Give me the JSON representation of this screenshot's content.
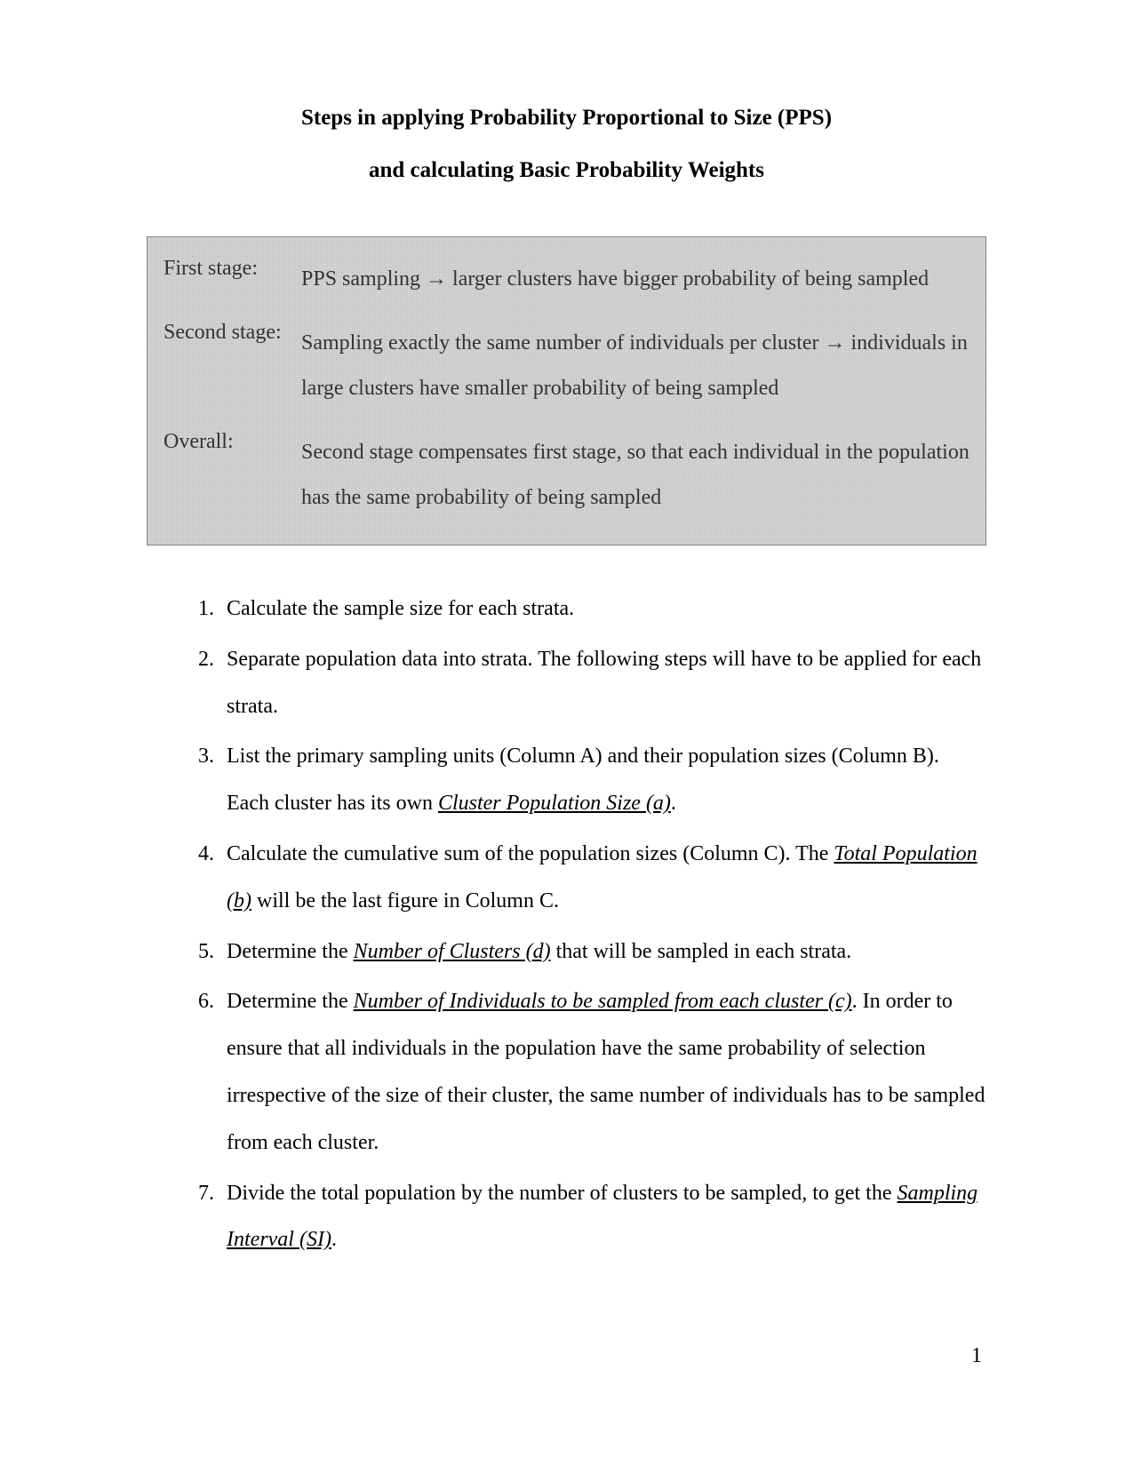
{
  "title": {
    "line1": "Steps in applying Probability Proportional to Size (PPS)",
    "line2": "and calculating Basic Probability Weights"
  },
  "callout": {
    "rows": [
      {
        "label": "First stage:",
        "text": "PPS sampling → larger clusters have bigger probability of being sampled"
      },
      {
        "label": "Second stage:",
        "text": "Sampling exactly the same number of individuals per cluster → individuals in large clusters have smaller probability of being sampled"
      },
      {
        "label": "Overall:",
        "text": "Second stage compensates first stage, so that each individual in the population has the same probability of being sampled"
      }
    ]
  },
  "steps": [
    {
      "num": "1.",
      "parts": [
        {
          "t": "Calculate the sample size for each strata."
        }
      ]
    },
    {
      "num": "2.",
      "parts": [
        {
          "t": "Separate population data into strata. The following steps will have to be applied for each strata."
        }
      ]
    },
    {
      "num": "3.",
      "parts": [
        {
          "t": "List the primary sampling units (Column A) and their population sizes (Column B). Each cluster has its own "
        },
        {
          "t": "Cluster Population Size (a)",
          "u": true
        },
        {
          "t": "."
        }
      ]
    },
    {
      "num": "4.",
      "parts": [
        {
          "t": "Calculate the cumulative sum of the population sizes (Column C). The "
        },
        {
          "t": "Total Population (b)",
          "u": true
        },
        {
          "t": " will be the last figure in Column C."
        }
      ]
    },
    {
      "num": "5.",
      "parts": [
        {
          "t": "Determine the "
        },
        {
          "t": "Number of Clusters (d)",
          "u": true
        },
        {
          "t": " that will be sampled in each strata."
        }
      ]
    },
    {
      "num": "6.",
      "parts": [
        {
          "t": "Determine the "
        },
        {
          "t": "Number of Individuals to be sampled from each cluster (c)",
          "u": true
        },
        {
          "t": ". In order to ensure that all individuals in the population have the same probability of selection irrespective of the size of their cluster, the same number of individuals has to be sampled from each cluster."
        }
      ]
    },
    {
      "num": "7.",
      "parts": [
        {
          "t": "Divide the total population by the number of clusters to be sampled, to get the "
        },
        {
          "t": "Sampling Interval (SI)",
          "u": true
        },
        {
          "t": "."
        }
      ]
    }
  ],
  "pageNumber": "1"
}
